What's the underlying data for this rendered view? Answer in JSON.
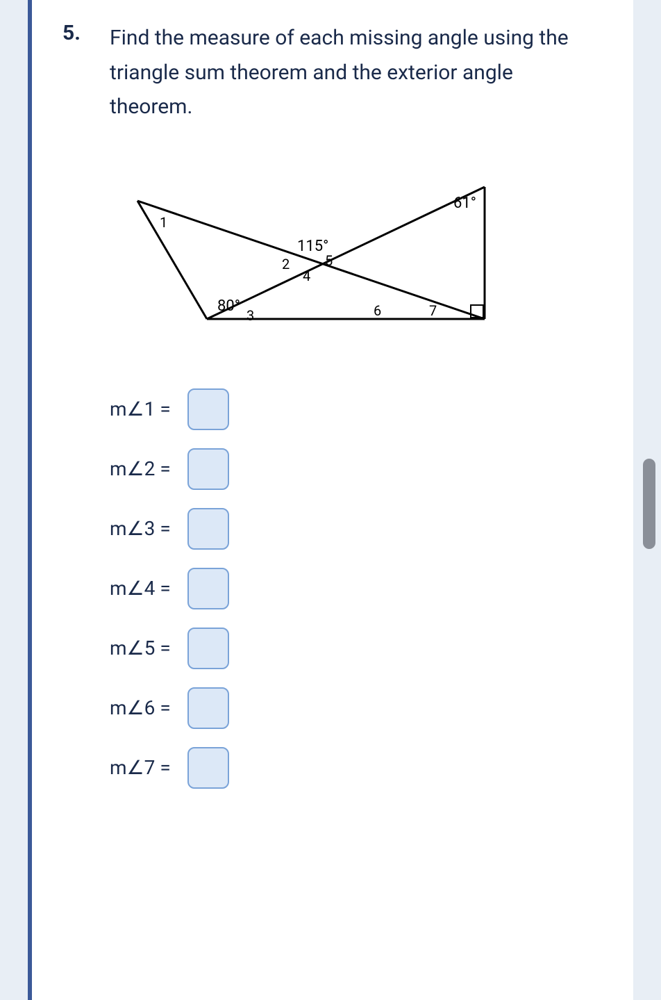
{
  "question": {
    "number": "5.",
    "text": "Find the measure of each missing angle using the triangle sum theorem and the exterior angle theorem."
  },
  "diagram": {
    "known_angles": {
      "top_right": "61°",
      "bottom_left": "80°",
      "center_top": "115°"
    },
    "angle_labels": {
      "a1": "1",
      "a2": "2",
      "a3": "3",
      "a4": "4",
      "a5": "5",
      "a6": "6",
      "a7": "7"
    },
    "right_angle_marker": true
  },
  "answers": {
    "items": [
      {
        "label": "m∠1 =",
        "value": ""
      },
      {
        "label": "m∠2 =",
        "value": ""
      },
      {
        "label": "m∠3 =",
        "value": ""
      },
      {
        "label": "m∠4 =",
        "value": ""
      },
      {
        "label": "m∠5 =",
        "value": ""
      },
      {
        "label": "m∠6 =",
        "value": ""
      },
      {
        "label": "m∠7 =",
        "value": ""
      }
    ]
  }
}
